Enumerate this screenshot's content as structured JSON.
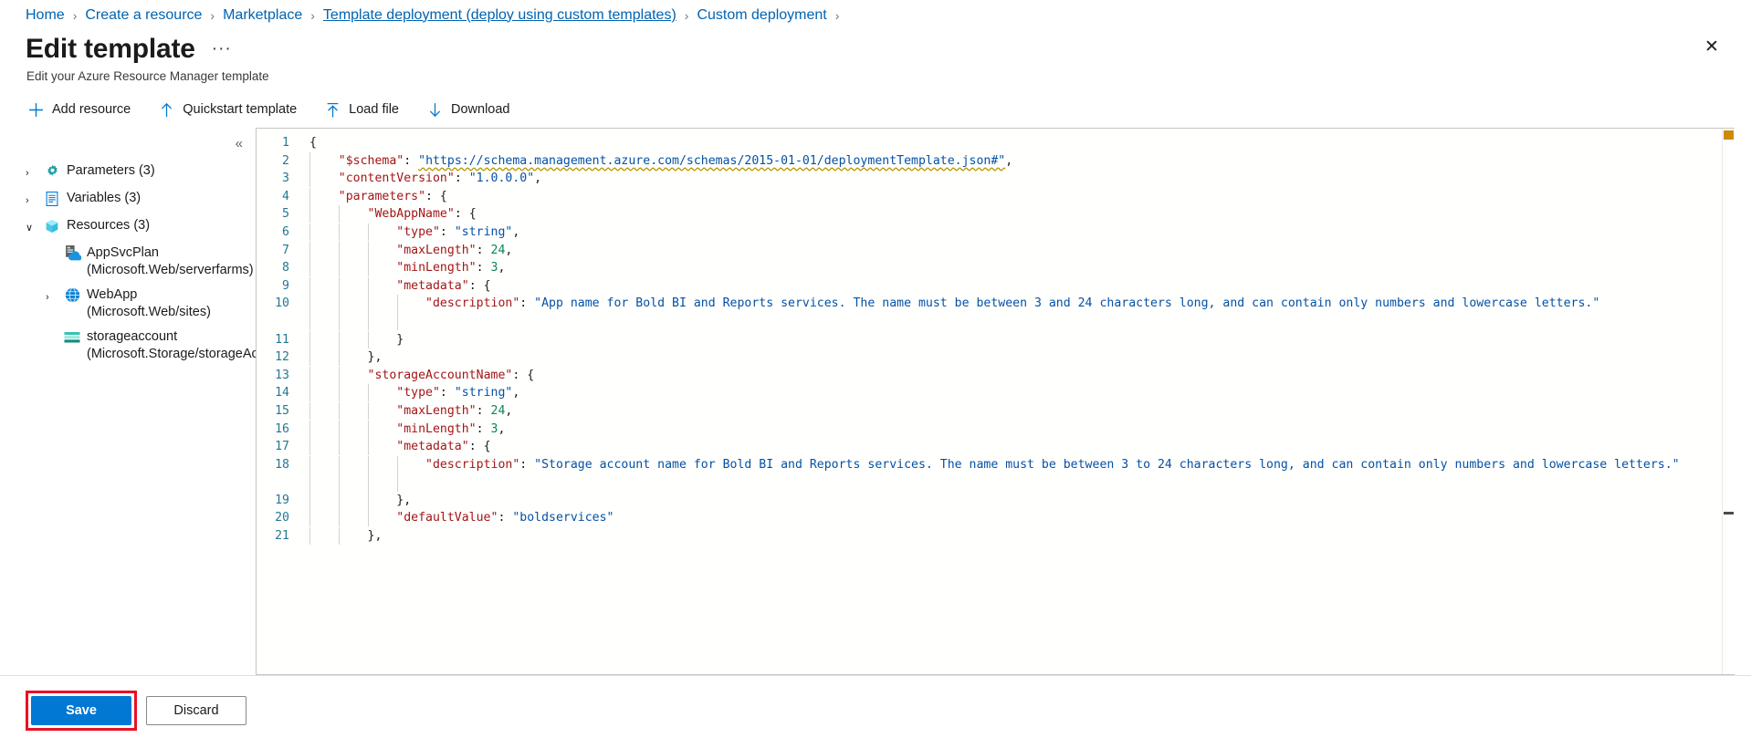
{
  "breadcrumb": {
    "items": [
      {
        "label": "Home",
        "underline": false
      },
      {
        "label": "Create a resource",
        "underline": false
      },
      {
        "label": "Marketplace",
        "underline": false
      },
      {
        "label": "Template deployment (deploy using custom templates)",
        "underline": true
      },
      {
        "label": "Custom deployment",
        "underline": false
      }
    ],
    "separator": "›",
    "trailing_separator": "›"
  },
  "header": {
    "title": "Edit template",
    "more_label": "···",
    "subtitle": "Edit your Azure Resource Manager template",
    "close_label": "✕"
  },
  "toolbar": {
    "items": [
      {
        "label": "Add resource",
        "icon": "plus-icon"
      },
      {
        "label": "Quickstart template",
        "icon": "arrow-up-icon"
      },
      {
        "label": "Load file",
        "icon": "upload-icon"
      },
      {
        "label": "Download",
        "icon": "arrow-down-icon"
      }
    ]
  },
  "tree": {
    "collapse_label": "«",
    "nodes": [
      {
        "chevron": "›",
        "icon": "gear-icon",
        "label": "Parameters (3)",
        "indent": 0
      },
      {
        "chevron": "›",
        "icon": "document-icon",
        "label": "Variables (3)",
        "indent": 0
      },
      {
        "chevron": "∨",
        "icon": "cube-icon",
        "label": "Resources (3)",
        "indent": 0
      },
      {
        "chevron": "",
        "icon": "appservice-icon",
        "label": "AppSvcPlan\n(Microsoft.Web/serverfarms)",
        "indent": 1
      },
      {
        "chevron": "›",
        "icon": "webapp-icon",
        "label": "WebApp (Microsoft.Web/sites)",
        "indent": 1
      },
      {
        "chevron": "",
        "icon": "storage-icon",
        "label": "storageaccount\n(Microsoft.Storage/storageAccoun",
        "indent": 1
      }
    ]
  },
  "editor": {
    "line_numbers": [
      "1",
      "2",
      "3",
      "4",
      "5",
      "6",
      "7",
      "8",
      "9",
      "10",
      "11",
      "12",
      "13",
      "14",
      "15",
      "16",
      "17",
      "18",
      "19",
      "20",
      "21"
    ],
    "lines": [
      {
        "num": 1,
        "indent": 0,
        "tokens": [
          {
            "t": "p",
            "v": "{"
          }
        ]
      },
      {
        "num": 2,
        "indent": 1,
        "tokens": [
          {
            "t": "k",
            "v": "\"$schema\""
          },
          {
            "t": "p",
            "v": ": "
          },
          {
            "t": "squig",
            "v": "\"https://schema.management.azure.com/schemas/2015-01-01/deploymentTemplate.json#\""
          },
          {
            "t": "p",
            "v": ","
          }
        ]
      },
      {
        "num": 3,
        "indent": 1,
        "tokens": [
          {
            "t": "k",
            "v": "\"contentVersion\""
          },
          {
            "t": "p",
            "v": ": "
          },
          {
            "t": "s",
            "v": "\"1.0.0.0\""
          },
          {
            "t": "p",
            "v": ","
          }
        ]
      },
      {
        "num": 4,
        "indent": 1,
        "tokens": [
          {
            "t": "k",
            "v": "\"parameters\""
          },
          {
            "t": "p",
            "v": ": {"
          }
        ]
      },
      {
        "num": 5,
        "indent": 2,
        "tokens": [
          {
            "t": "k",
            "v": "\"WebAppName\""
          },
          {
            "t": "p",
            "v": ": {"
          }
        ]
      },
      {
        "num": 6,
        "indent": 3,
        "tokens": [
          {
            "t": "k",
            "v": "\"type\""
          },
          {
            "t": "p",
            "v": ": "
          },
          {
            "t": "s",
            "v": "\"string\""
          },
          {
            "t": "p",
            "v": ","
          }
        ]
      },
      {
        "num": 7,
        "indent": 3,
        "tokens": [
          {
            "t": "k",
            "v": "\"maxLength\""
          },
          {
            "t": "p",
            "v": ": "
          },
          {
            "t": "n",
            "v": "24"
          },
          {
            "t": "p",
            "v": ","
          }
        ]
      },
      {
        "num": 8,
        "indent": 3,
        "tokens": [
          {
            "t": "k",
            "v": "\"minLength\""
          },
          {
            "t": "p",
            "v": ": "
          },
          {
            "t": "n",
            "v": "3"
          },
          {
            "t": "p",
            "v": ","
          }
        ]
      },
      {
        "num": 9,
        "indent": 3,
        "tokens": [
          {
            "t": "k",
            "v": "\"metadata\""
          },
          {
            "t": "p",
            "v": ": {"
          }
        ]
      },
      {
        "num": 10,
        "indent": 4,
        "wrap": true,
        "tokens": [
          {
            "t": "k",
            "v": "\"description\""
          },
          {
            "t": "p",
            "v": ": "
          },
          {
            "t": "s",
            "v": "\"App name for Bold BI and Reports services. The name must be between 3 and 24 characters long, and can contain only numbers and lowercase letters.\""
          }
        ]
      },
      {
        "num": 11,
        "indent": 3,
        "tokens": [
          {
            "t": "p",
            "v": "}"
          }
        ]
      },
      {
        "num": 12,
        "indent": 2,
        "tokens": [
          {
            "t": "p",
            "v": "},"
          }
        ]
      },
      {
        "num": 13,
        "indent": 2,
        "tokens": [
          {
            "t": "k",
            "v": "\"storageAccountName\""
          },
          {
            "t": "p",
            "v": ": {"
          }
        ]
      },
      {
        "num": 14,
        "indent": 3,
        "tokens": [
          {
            "t": "k",
            "v": "\"type\""
          },
          {
            "t": "p",
            "v": ": "
          },
          {
            "t": "s",
            "v": "\"string\""
          },
          {
            "t": "p",
            "v": ","
          }
        ]
      },
      {
        "num": 15,
        "indent": 3,
        "tokens": [
          {
            "t": "k",
            "v": "\"maxLength\""
          },
          {
            "t": "p",
            "v": ": "
          },
          {
            "t": "n",
            "v": "24"
          },
          {
            "t": "p",
            "v": ","
          }
        ]
      },
      {
        "num": 16,
        "indent": 3,
        "tokens": [
          {
            "t": "k",
            "v": "\"minLength\""
          },
          {
            "t": "p",
            "v": ": "
          },
          {
            "t": "n",
            "v": "3"
          },
          {
            "t": "p",
            "v": ","
          }
        ]
      },
      {
        "num": 17,
        "indent": 3,
        "tokens": [
          {
            "t": "k",
            "v": "\"metadata\""
          },
          {
            "t": "p",
            "v": ": {"
          }
        ]
      },
      {
        "num": 18,
        "indent": 4,
        "wrap": true,
        "tokens": [
          {
            "t": "k",
            "v": "\"description\""
          },
          {
            "t": "p",
            "v": ": "
          },
          {
            "t": "s",
            "v": "\"Storage account name for Bold BI and Reports services. The name must be between 3 to 24 characters long, and can contain only numbers and lowercase letters.\""
          }
        ]
      },
      {
        "num": 19,
        "indent": 3,
        "tokens": [
          {
            "t": "p",
            "v": "},"
          }
        ]
      },
      {
        "num": 20,
        "indent": 3,
        "tokens": [
          {
            "t": "k",
            "v": "\"defaultValue\""
          },
          {
            "t": "p",
            "v": ": "
          },
          {
            "t": "s",
            "v": "\"boldservices\""
          }
        ]
      },
      {
        "num": 21,
        "indent": 2,
        "tokens": [
          {
            "t": "p",
            "v": "},"
          }
        ]
      }
    ]
  },
  "footer": {
    "save_label": "Save",
    "discard_label": "Discard"
  },
  "colors": {
    "accent": "#0078d4",
    "breadcrumb_link": "#0063b1",
    "json_key": "#a31515",
    "json_string": "#0451a5",
    "json_number": "#098658",
    "line_number": "#237893",
    "highlight_box": "#e81123",
    "warning_marker": "#cc8b00"
  }
}
